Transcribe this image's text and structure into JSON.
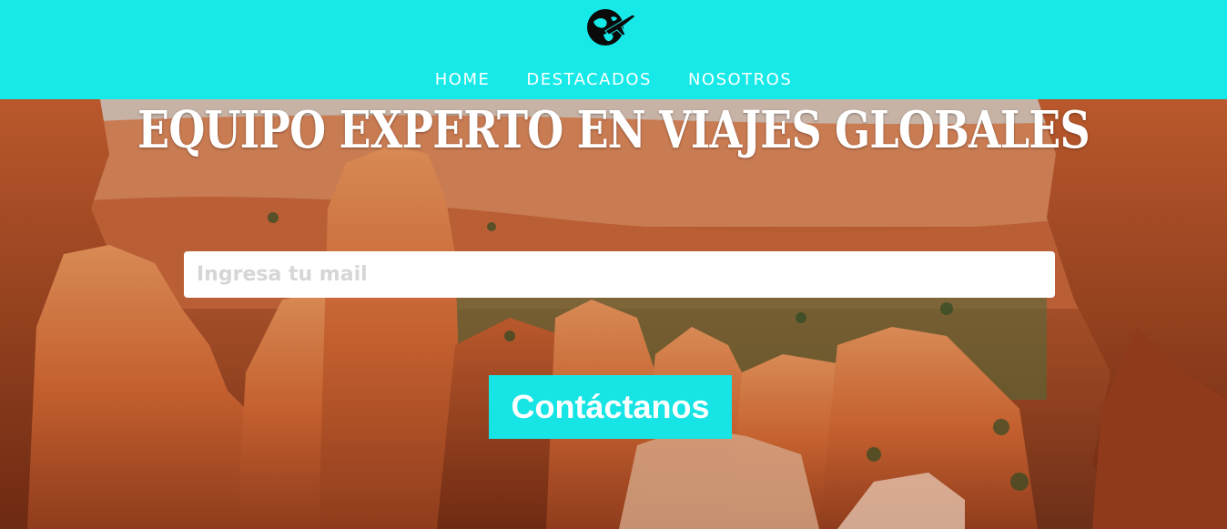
{
  "header": {
    "logo_icon": "globe-airplane-icon",
    "nav": [
      {
        "label": "HOME"
      },
      {
        "label": "DESTACADOS"
      },
      {
        "label": "NOSOTROS"
      }
    ]
  },
  "hero": {
    "headline": "EQUIPO EXPERTO EN VIAJES GLOBALES",
    "email": {
      "value": "",
      "placeholder": "Ingresa tu mail"
    },
    "cta_label": "Contáctanos"
  },
  "colors": {
    "accent": "#17e9e9",
    "text_light": "#ffffff"
  }
}
